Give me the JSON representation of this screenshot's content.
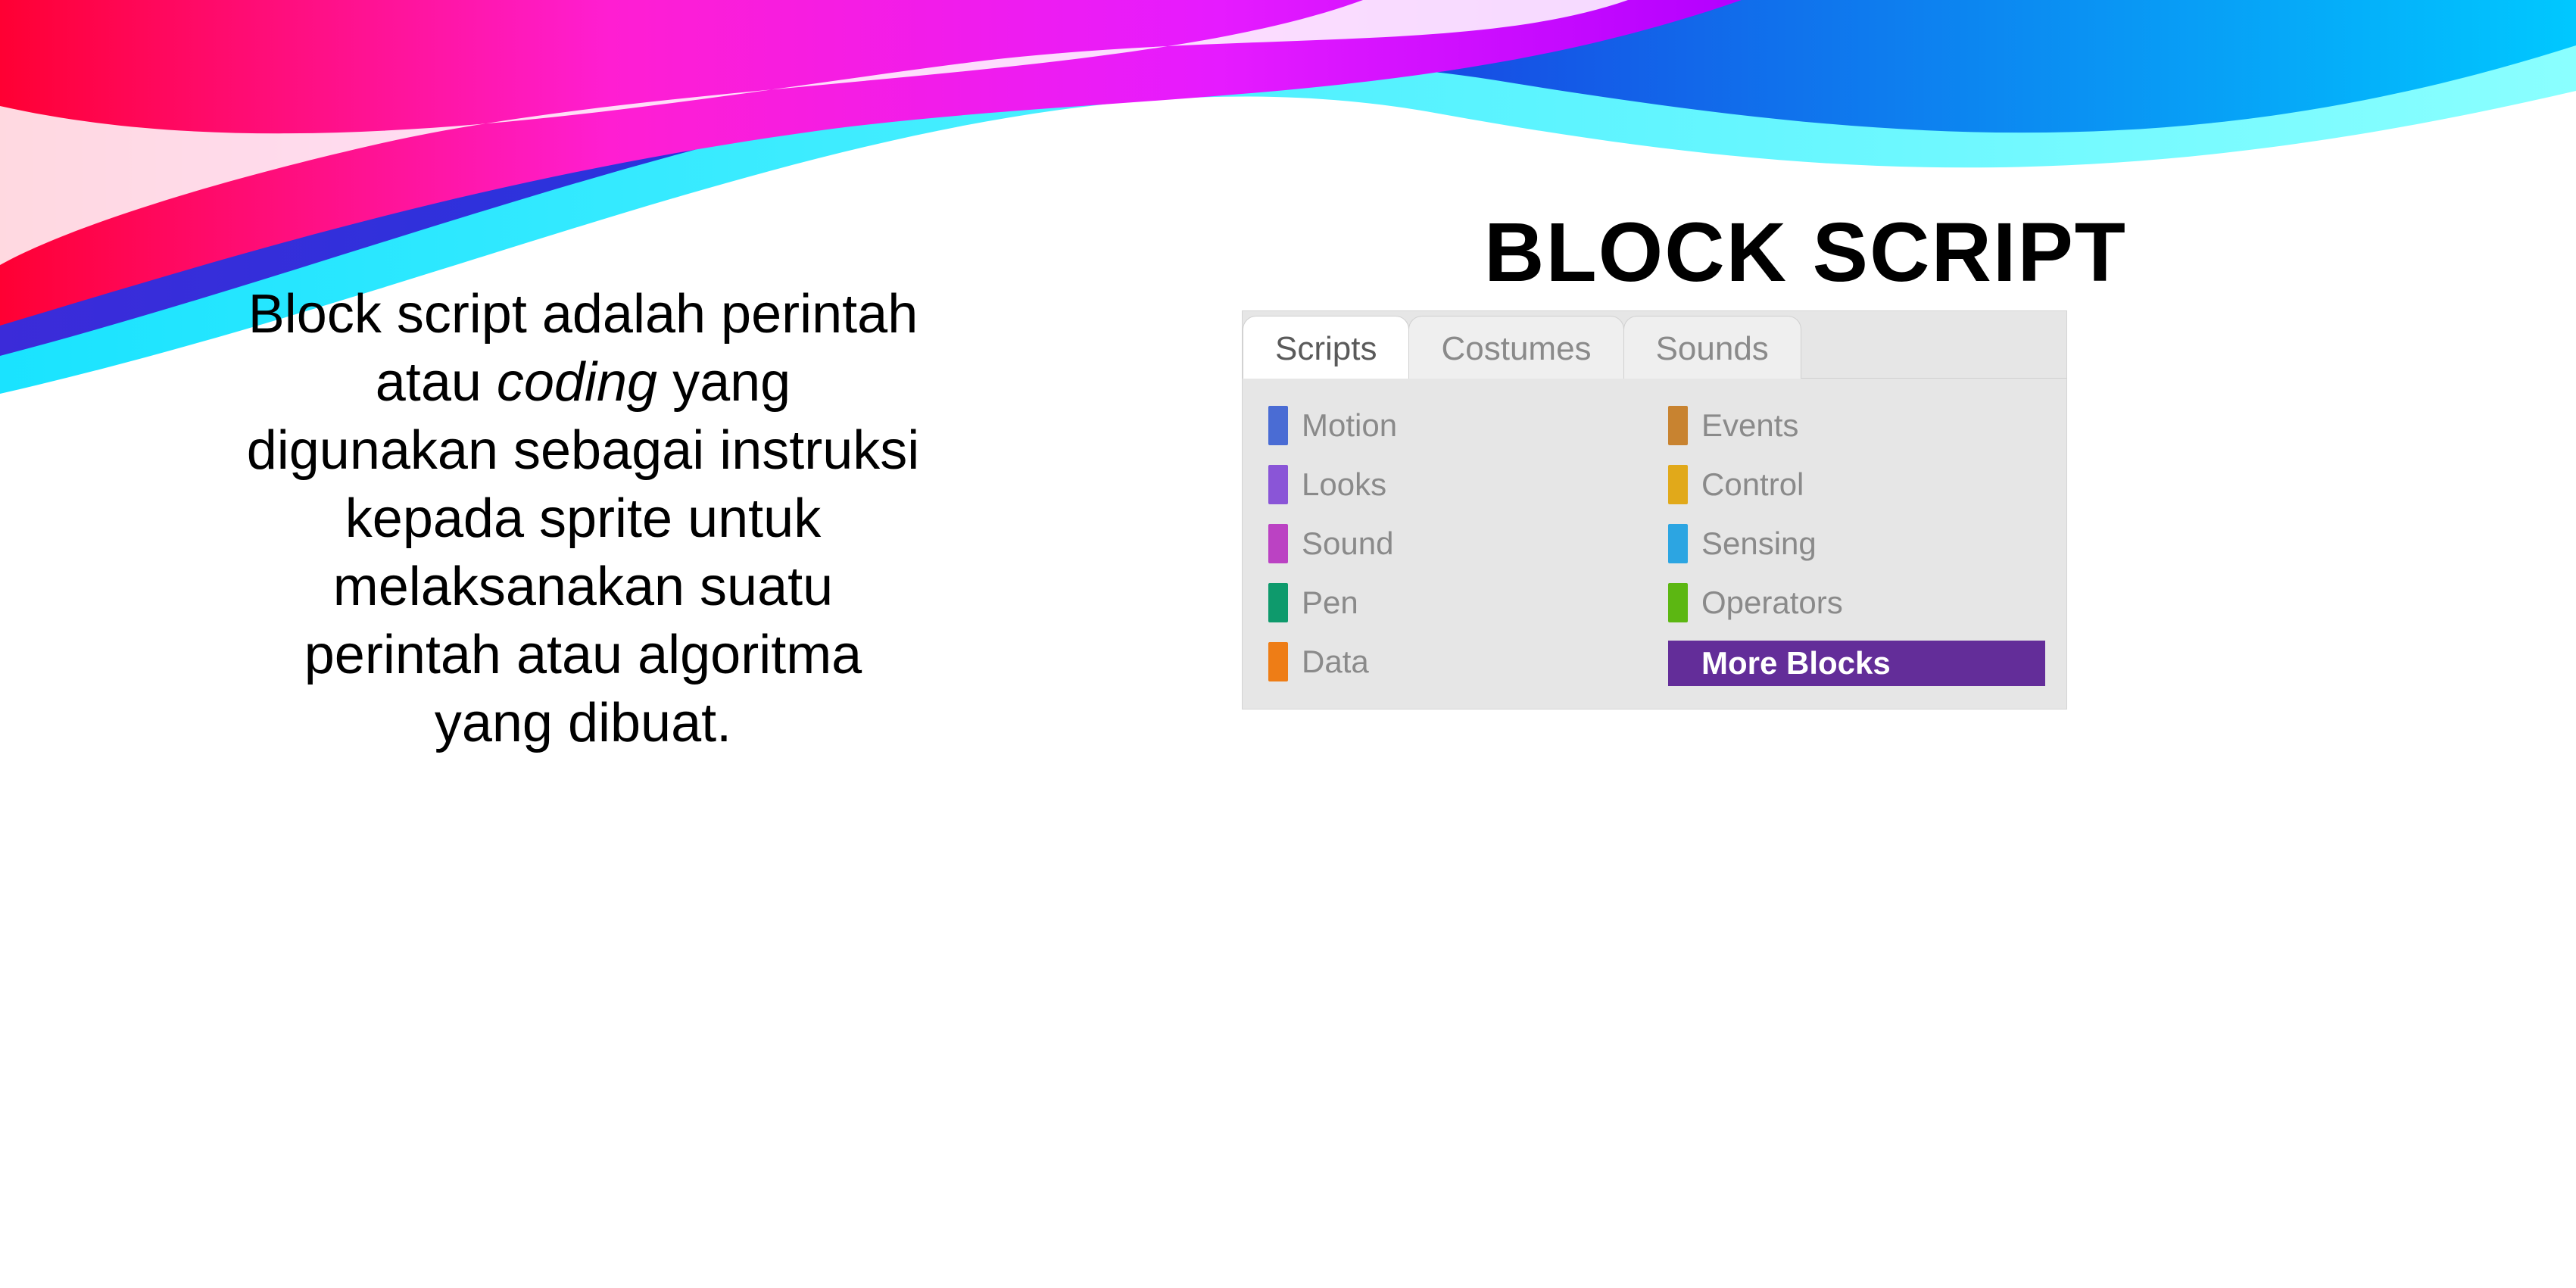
{
  "slide": {
    "title": "BLOCK SCRIPT",
    "body_pre": "Block script adalah perintah atau ",
    "body_italic": "coding",
    "body_post": " yang digunakan sebagai instruksi kepada sprite untuk melaksanakan suatu perintah atau algoritma yang dibuat."
  },
  "palette": {
    "tabs": {
      "scripts": "Scripts",
      "costumes": "Costumes",
      "sounds": "Sounds"
    },
    "categories": {
      "motion": {
        "label": "Motion",
        "color": "#4a6cd4"
      },
      "events": {
        "label": "Events",
        "color": "#c88330"
      },
      "looks": {
        "label": "Looks",
        "color": "#8a55d7"
      },
      "control": {
        "label": "Control",
        "color": "#e1a91a"
      },
      "sound": {
        "label": "Sound",
        "color": "#bb42c3"
      },
      "sensing": {
        "label": "Sensing",
        "color": "#2ca5e2"
      },
      "pen": {
        "label": "Pen",
        "color": "#0e9a6c"
      },
      "operators": {
        "label": "Operators",
        "color": "#5cb712"
      },
      "data": {
        "label": "Data",
        "color": "#ee7d16"
      },
      "moreblocks": {
        "label": "More Blocks",
        "color": "#632d99"
      }
    }
  }
}
